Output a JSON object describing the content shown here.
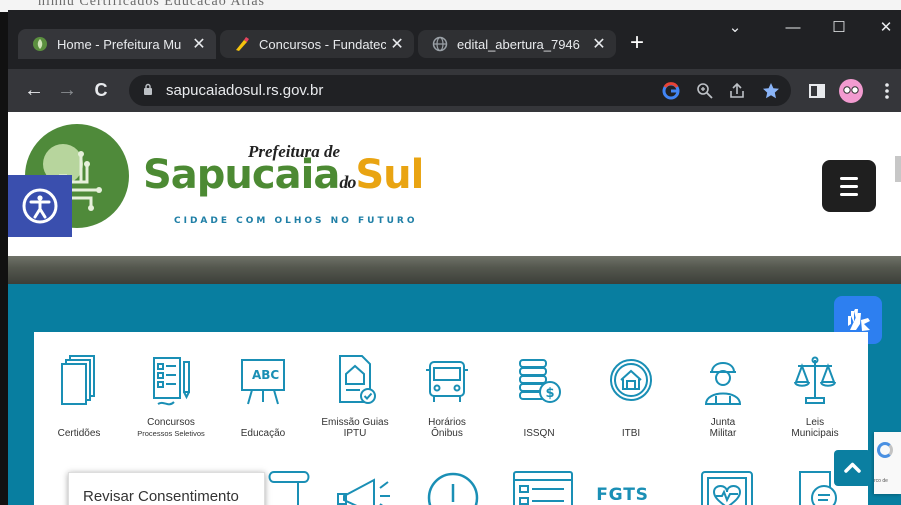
{
  "background": {
    "stray_text": "  ninnu   Certificados  Educacao   Atlas"
  },
  "tabs": [
    {
      "title": "Home - Prefeitura Mu",
      "favicon": "prefeitura-leaf-icon",
      "active": true
    },
    {
      "title": "Concursos - Fundatec",
      "favicon": "fundatec-pen-icon",
      "active": false
    },
    {
      "title": "edital_abertura_7946",
      "favicon": "globe-icon",
      "active": false
    }
  ],
  "tab_close": "✕",
  "new_tab": "+",
  "window_controls": {
    "tabsearch": "⌄",
    "minimize": "—",
    "maximize": "☐",
    "close": "✕"
  },
  "toolbar": {
    "back": "←",
    "forward": "→",
    "reload": "C",
    "url": "sapucaiadosul.rs.gov.br"
  },
  "site": {
    "logo_top": "Prefeitura de",
    "logo_main_a": "Sapucaia",
    "logo_do": "do",
    "logo_main_b": "Sul",
    "tagline": "CIDADE COM OLHOS NO FUTURO"
  },
  "services": [
    {
      "label": "Certidões",
      "sub": "",
      "icon": "documents-stack-icon"
    },
    {
      "label": "Concursos",
      "sub": "Processos Seletivos",
      "icon": "form-pencil-icon"
    },
    {
      "label": "Educação",
      "sub": "",
      "icon": "chalkboard-abc-icon"
    },
    {
      "label": "Emissão Guias",
      "sub": "IPTU",
      "icon": "house-document-icon"
    },
    {
      "label": "Horários",
      "sub": "Ônibus",
      "icon": "bus-icon"
    },
    {
      "label": "ISSQN",
      "sub": "",
      "icon": "coins-stack-icon"
    },
    {
      "label": "ITBI",
      "sub": "",
      "icon": "house-circle-icon"
    },
    {
      "label": "Junta",
      "sub": "Militar",
      "icon": "soldier-icon"
    },
    {
      "label": "Leis",
      "sub": "Municipais",
      "icon": "scales-icon"
    }
  ],
  "services_row2": [
    "documents-icon",
    "scroll-icon",
    "megaphone-icon",
    "alert-circle-icon",
    "form-window-icon",
    "FGTS",
    "heart-monitor-icon",
    "search-document-icon"
  ],
  "consent_button": "Revisar Consentimento",
  "recaptcha_text": "rco de"
}
